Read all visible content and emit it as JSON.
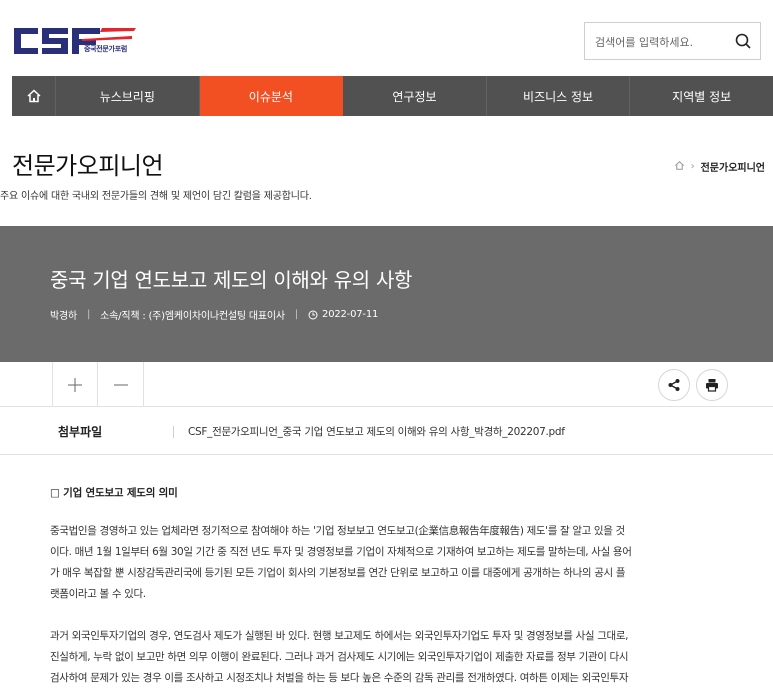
{
  "header": {
    "logo_text": "CSF",
    "logo_subtitle": "중국전문가포럼",
    "search_placeholder": "검색어를 입력하세요."
  },
  "nav": {
    "items": [
      {
        "label": "뉴스브리핑",
        "active": false
      },
      {
        "label": "이슈분석",
        "active": true
      },
      {
        "label": "연구정보",
        "active": false
      },
      {
        "label": "비즈니스 정보",
        "active": false
      },
      {
        "label": "지역별 정보",
        "active": false
      }
    ]
  },
  "page": {
    "title": "전문가오피니언",
    "description": "주요 이슈에 대한 국내외 전문가들의 견해 및 제언이 담긴 칼럼을 제공합니다.",
    "breadcrumb_current": "전문가오피니언"
  },
  "article": {
    "title": "중국 기업 연도보고 제도의 이해와 유의 사항",
    "author": "박경하",
    "affiliation": "소속/직책 : (주)엠케이차이나컨설팅 대표이사",
    "date": "2022-07-11",
    "attachment_label": "첨부파일",
    "attachment_file": "CSF_전문가오피니언_중국 기업 연도보고 제도의 이해와 유의 사항_박경하_202207.pdf",
    "section_heading": "□ 기업 연도보고 제도의 의미",
    "paragraph1": [
      "중국법인을 경영하고 있는 업체라면 정기적으로 참여해야 하는 '기업 정보보고 연도보고(企業信息報告年度報告) 제도'를 잘 알고 있을 것",
      "이다. 매년 1월 1일부터 6월 30일 기간 중 직전 년도 투자 및 경영정보를 기업이 자체적으로 기재하여 보고하는 제도를 말하는데, 사실 용어",
      "가 매우 복잡할 뿐 시장감독관리국에 등기된 모든 기업이 회사의 기본정보를 연간 단위로 보고하고 이를 대중에게 공개하는 하나의 공시 플",
      "랫폼이라고 볼 수 있다."
    ],
    "paragraph2": [
      "과거 외국인투자기업의 경우, 연도검사 제도가 실행된 바 있다. 현행 보고제도 하에서는 외국인투자기업도 투자 및 경영정보를 사실 그대로,",
      "진실하게, 누락 없이 보고만 하면 의무 이행이 완료된다. 그러나 과거 검사제도 시기에는 외국인투자기업이 제출한 자료를 정부 기관이 다시",
      "검사하여 문제가 있는 경우 이를 조사하고 시정조치나 처벌을 하는 등 보다 높은 수준의 감독 관리를 전개하였다. 여하튼 이제는 외국인투자"
    ]
  },
  "colors": {
    "brand_blue": "#2a2f7a",
    "brand_red": "#e3262d",
    "nav_bg": "#515151",
    "nav_active": "#f25022",
    "banner_bg": "#6b6b6b"
  },
  "icons": [
    "home-icon",
    "search-icon",
    "clock-icon",
    "plus-icon",
    "minus-icon",
    "share-icon",
    "print-icon"
  ]
}
